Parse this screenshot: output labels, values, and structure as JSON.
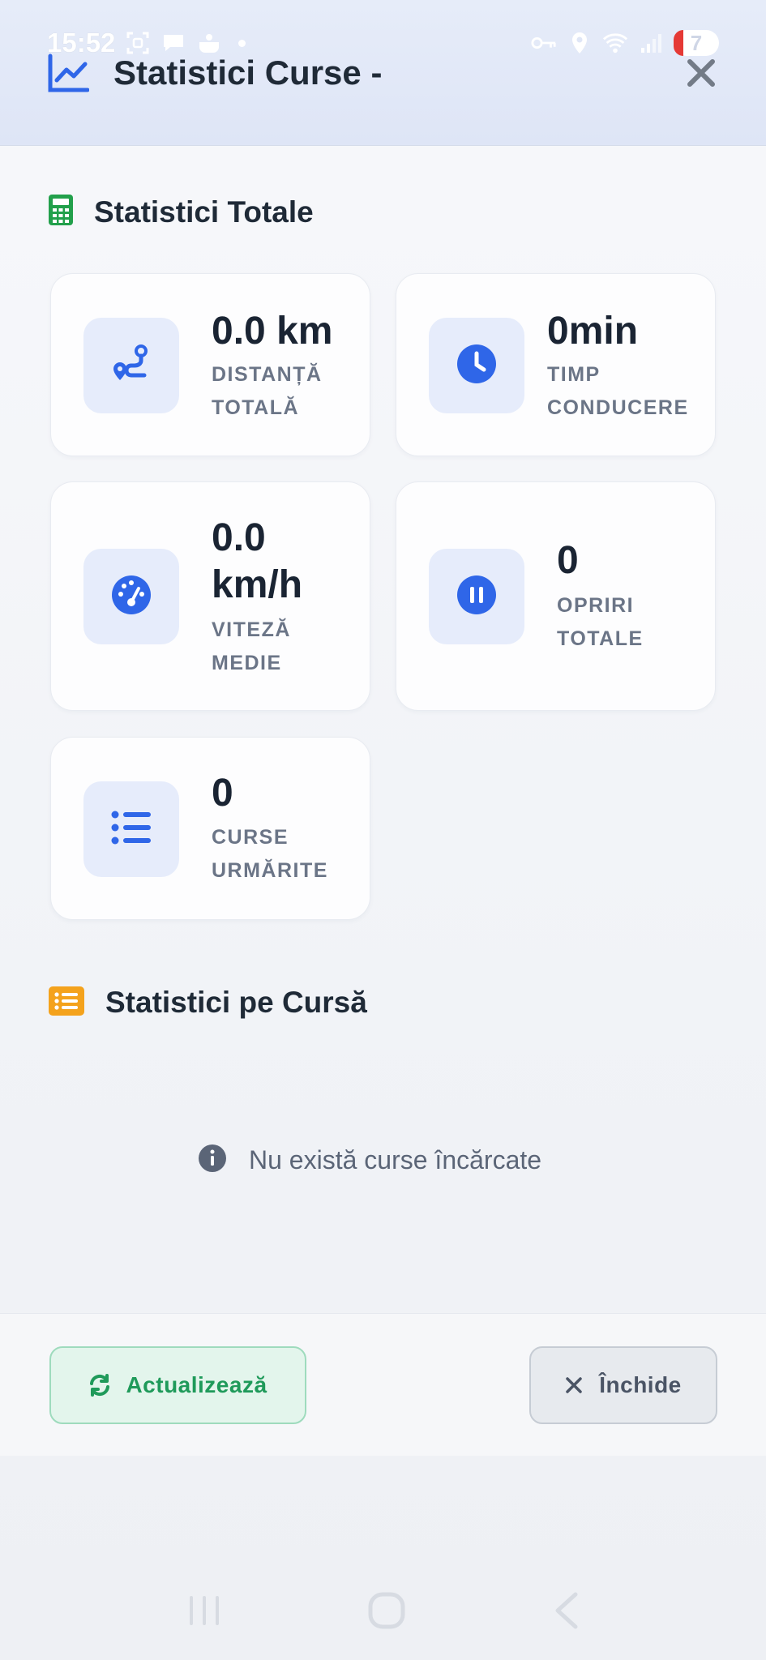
{
  "status_bar": {
    "time": "15:52",
    "battery": "7",
    "icons_left": [
      "screenshot-icon",
      "chat-icon",
      "cloud-icon"
    ],
    "icons_right": [
      "vpn-key-icon",
      "location-icon",
      "wifi-icon",
      "signal-icon"
    ]
  },
  "header": {
    "title": "Statistici Curse -",
    "icon": "line-chart-icon",
    "accent": "#2f66e8"
  },
  "totals": {
    "heading": "Statistici Totale",
    "heading_icon": "calculator-icon",
    "heading_icon_color": "#22a04b",
    "cards": [
      {
        "value": "0.0 km",
        "label_line1": "DISTANȚĂ",
        "label_line2": "TOTALĂ",
        "icon": "route-icon"
      },
      {
        "value": "0min",
        "label_line1": "TIMP",
        "label_line2": "CONDUCERE",
        "icon": "clock-icon"
      },
      {
        "value_line1": "0.0",
        "value_line2": "km/h",
        "label_line1": "VITEZĂ",
        "label_line2": "MEDIE",
        "icon": "speedometer-icon"
      },
      {
        "value": "0",
        "label_line1": "OPRIRI",
        "label_line2": "TOTALE",
        "icon": "pause-icon"
      },
      {
        "value": "0",
        "label_line1": "CURSE",
        "label_line2": "URMĂRITE",
        "icon": "list-icon"
      }
    ]
  },
  "per_course": {
    "heading": "Statistici pe Cursă",
    "heading_icon": "list-alt-icon",
    "heading_icon_color": "#f4a21c",
    "empty_text": "Nu există curse încărcate"
  },
  "footer": {
    "refresh_label": "Actualizează",
    "close_label": "Închide"
  }
}
